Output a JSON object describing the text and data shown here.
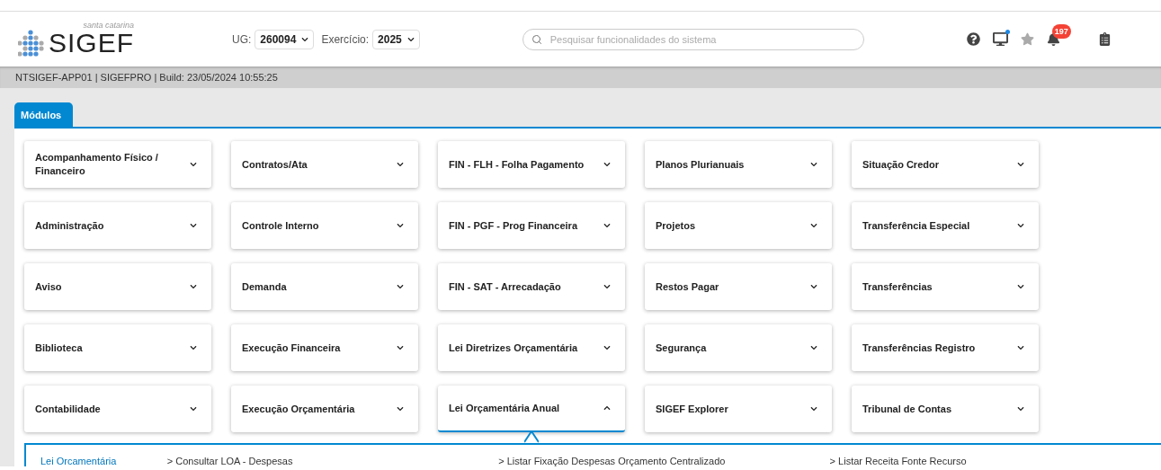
{
  "logo": {
    "subtitle": "santa catarina",
    "name": "SIGEF"
  },
  "selectors": [
    {
      "label": "UG:",
      "value": "260094"
    },
    {
      "label": "Exercício:",
      "value": "2025"
    }
  ],
  "search": {
    "placeholder": "Pesquisar funcionalidades do sistema"
  },
  "notifications": {
    "count": "197"
  },
  "status_bar": "NTSIGEF-APP01 | SIGEFPRO | Build: 23/05/2024 10:55:25",
  "tabs": [
    {
      "label": "Módulos",
      "selected": true
    }
  ],
  "modules": [
    {
      "label": "Acompanhamento Físico / Financeiro",
      "expanded": false
    },
    {
      "label": "Administração",
      "expanded": false
    },
    {
      "label": "Aviso",
      "expanded": false
    },
    {
      "label": "Biblioteca",
      "expanded": false
    },
    {
      "label": "Contabilidade",
      "expanded": false
    },
    {
      "label": "Contratos/Ata",
      "expanded": false
    },
    {
      "label": "Controle Interno",
      "expanded": false
    },
    {
      "label": "Demanda",
      "expanded": false
    },
    {
      "label": "Execução Financeira",
      "expanded": false
    },
    {
      "label": "Execução Orçamentária",
      "expanded": false
    },
    {
      "label": "FIN - FLH - Folha Pagamento",
      "expanded": false
    },
    {
      "label": "FIN - PGF - Prog Financeira",
      "expanded": false
    },
    {
      "label": "FIN - SAT - Arrecadação",
      "expanded": false
    },
    {
      "label": "Lei Diretrizes Orçamentária",
      "expanded": false
    },
    {
      "label": "Lei Orçamentária Anual",
      "expanded": true
    },
    {
      "label": "Planos Plurianuais",
      "expanded": false
    },
    {
      "label": "Projetos",
      "expanded": false
    },
    {
      "label": "Restos Pagar",
      "expanded": false
    },
    {
      "label": "Segurança",
      "expanded": false
    },
    {
      "label": "SIGEF Explorer",
      "expanded": false
    },
    {
      "label": "Situação Credor",
      "expanded": false
    },
    {
      "label": "Transferência Especial",
      "expanded": false
    },
    {
      "label": "Transferências",
      "expanded": false
    },
    {
      "label": "Transferências Registro",
      "expanded": false
    },
    {
      "label": "Tribunal de Contas",
      "expanded": false
    }
  ],
  "submenu": {
    "section": "Lei Orcamentária",
    "items": [
      {
        "marker": ">",
        "label": "Consultar LOA - Despesas"
      },
      {
        "marker": ">",
        "label": "Listar Fixação Despesas Orçamento Centralizado"
      },
      {
        "marker": ">",
        "label": "Listar Receita Fonte Recurso"
      }
    ]
  }
}
